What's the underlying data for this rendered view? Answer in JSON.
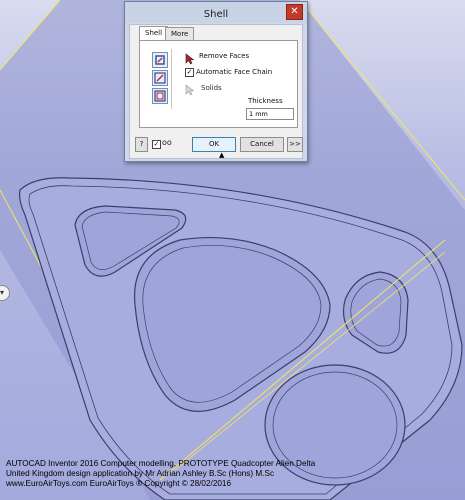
{
  "dialog": {
    "title": "Shell",
    "close_glyph": "✕",
    "tabs": [
      {
        "label": "Shell",
        "active": true
      },
      {
        "label": "More",
        "active": false
      }
    ],
    "options": {
      "remove_faces": "Remove Faces",
      "automatic_face_chain": "Automatic Face Chain",
      "automatic_face_chain_checked": true,
      "solids": "Solids"
    },
    "thickness": {
      "label": "Thickness",
      "value": "1 mm"
    },
    "buttons": {
      "help": "?",
      "ok": "OK",
      "cancel": "Cancel",
      "more": ">>"
    },
    "preview_checked": true,
    "collapse_glyph": "▲"
  },
  "viewport": {
    "side_tab_glyph": "▾",
    "colors": {
      "background_top": "#d9dcef",
      "background_bottom": "#a3a9dc",
      "part_face": "#a8ade0",
      "edge_line": "#3a3f66",
      "sketch_line": "#f2e85a"
    }
  },
  "caption": {
    "line1": "AUTOCAD Inventor 2016 Computer modelling,  PROTOTYPE Quadcopter Alien Delta",
    "line2": "United Kingdom design application by Mr Adrian Ashley B.Sc (Hons) M.Sc",
    "line3": "www.EuroAirToys.com     EuroAirToys ® Copyright © 28/02/2016"
  }
}
